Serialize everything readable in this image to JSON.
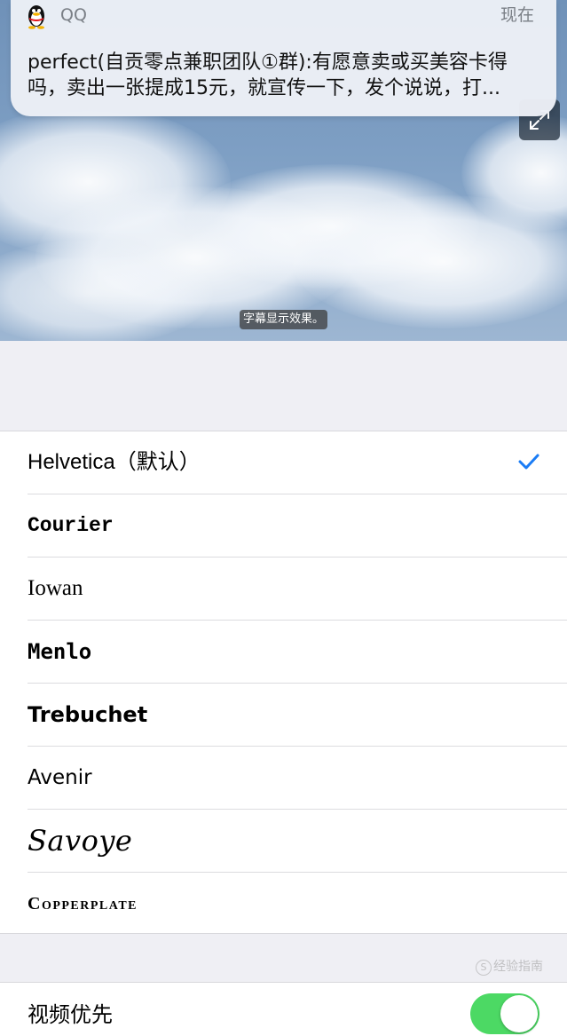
{
  "notification": {
    "app_name": "QQ",
    "time": "现在",
    "message": "perfect(自贡零点兼职团队①群):有愿意卖或买美容卡得吗，卖出一张提成15元，就宣传一下，发个说说，打..."
  },
  "preview": {
    "subtitle": "字幕显示效果。",
    "expand_icon": "expand-arrows-icon"
  },
  "font_list": {
    "items": [
      {
        "label": "Helvetica（默认）",
        "selected": true
      },
      {
        "label": "Courier",
        "selected": false
      },
      {
        "label": "Iowan",
        "selected": false
      },
      {
        "label": "Menlo",
        "selected": false
      },
      {
        "label": "Trebuchet",
        "selected": false
      },
      {
        "label": "Avenir",
        "selected": false
      },
      {
        "label": "Savoye",
        "selected": false
      },
      {
        "label": "Copperplate",
        "selected": false
      }
    ],
    "check_color": "#1a7cf5"
  },
  "bottom_setting": {
    "label": "视频优先",
    "toggle_on": true,
    "toggle_color": "#4cd964"
  },
  "watermark": {
    "text": "经验指南"
  }
}
